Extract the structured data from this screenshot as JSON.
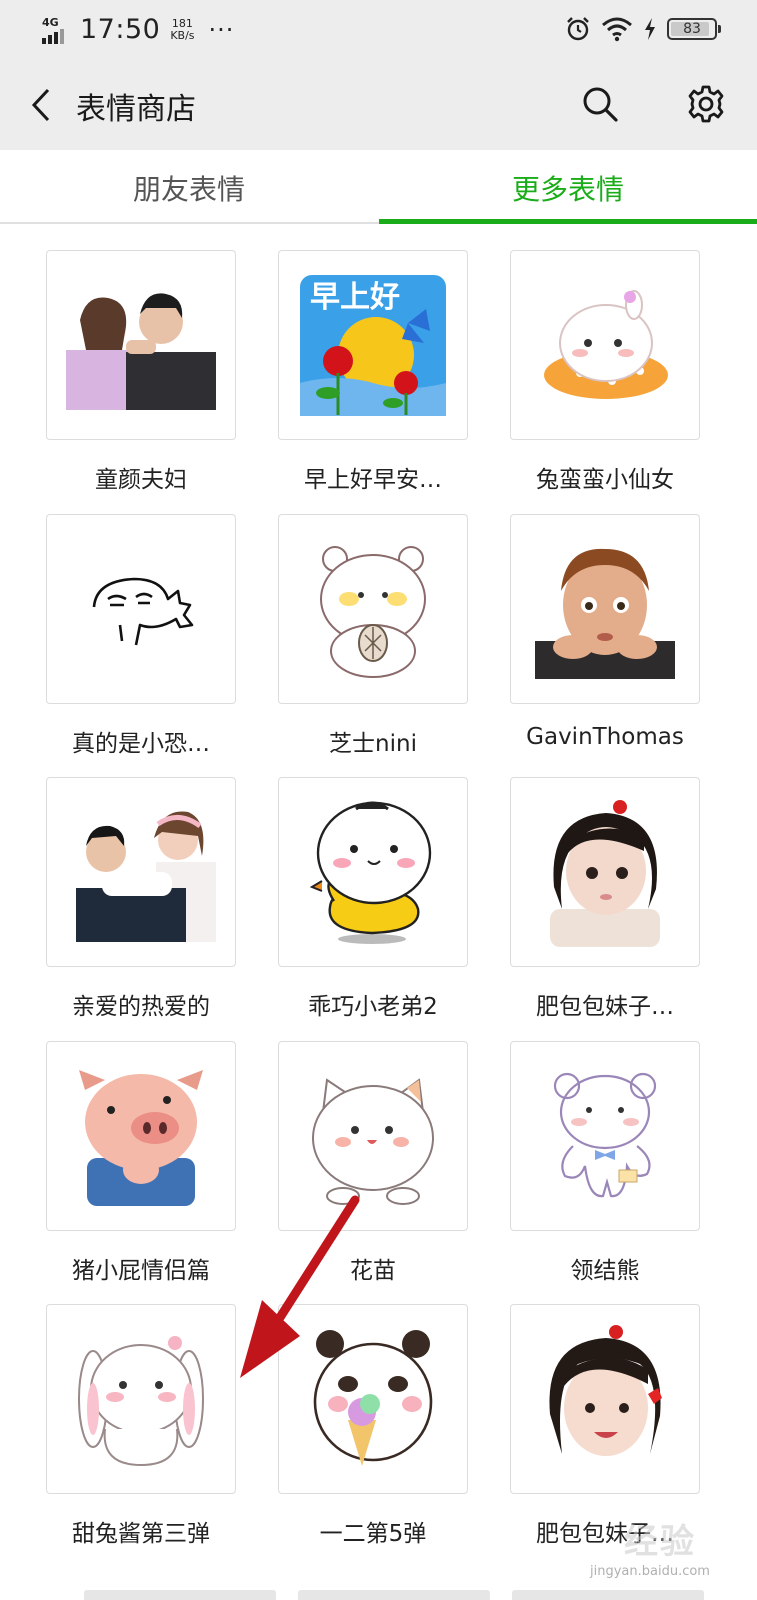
{
  "status_bar": {
    "network": "4G",
    "time": "17:50",
    "speed_value": "181",
    "speed_unit": "KB/s",
    "more": "···",
    "battery": "83"
  },
  "header": {
    "title": "表情商店"
  },
  "tabs": [
    {
      "label": "朋友表情",
      "active": false
    },
    {
      "label": "更多表情",
      "active": true
    }
  ],
  "stickers": [
    {
      "label": "童颜夫妇"
    },
    {
      "label": "早上好早安…",
      "image_text": "早上好"
    },
    {
      "label": "兔蛮蛮小仙女"
    },
    {
      "label": "真的是小恐…"
    },
    {
      "label": "芝士nini"
    },
    {
      "label": "GavinThomas"
    },
    {
      "label": "亲爱的热爱的"
    },
    {
      "label": "乖巧小老弟2"
    },
    {
      "label": "肥包包妹子…"
    },
    {
      "label": "猪小屁情侣篇"
    },
    {
      "label": "花苗"
    },
    {
      "label": "领结熊"
    },
    {
      "label": "甜兔酱第三弹"
    },
    {
      "label": "一二第5弹"
    },
    {
      "label": "肥包包妹子…"
    }
  ],
  "watermark": {
    "text": "经验",
    "site": "jingyan.baidu.com"
  },
  "colors": {
    "accent": "#1aad19",
    "header_bg": "#ededed",
    "arrow": "#c0161b"
  }
}
